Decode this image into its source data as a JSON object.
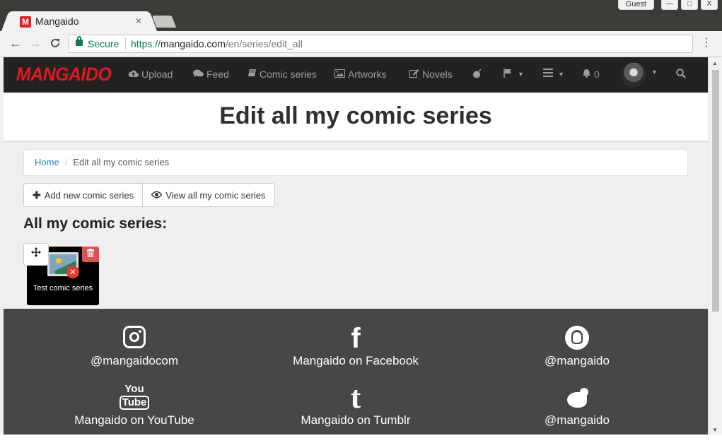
{
  "browser": {
    "window_buttons": {
      "guest": "Guest",
      "minimize": "—",
      "maximize": "□",
      "close": "X"
    },
    "tab": {
      "favicon": "M",
      "title": "Mangaido",
      "close": "×"
    },
    "nav": {
      "back": "←",
      "forward": "→",
      "reload": "C"
    },
    "address": {
      "secure_label": "Secure",
      "scheme": "https://",
      "host": "mangaido.com",
      "path": "/en/series/edit_all"
    },
    "menu": "⋮"
  },
  "navbar": {
    "brand": "MANGAIDO",
    "items": [
      {
        "icon": "☁",
        "label": "Upload"
      },
      {
        "icon": "💬",
        "label": "Feed"
      },
      {
        "icon": "📖",
        "label": "Comic series"
      },
      {
        "icon": "🖼",
        "label": "Artworks"
      },
      {
        "icon": "✎",
        "label": "Novels"
      }
    ],
    "notifications_count": "0"
  },
  "page": {
    "title": "Edit all my comic series",
    "breadcrumb": {
      "home": "Home",
      "separator": "/",
      "current": "Edit all my comic series"
    },
    "buttons": {
      "add_icon": "✚",
      "add_label": "Add new comic series",
      "view_icon": "👁",
      "view_label": "View all my comic series"
    },
    "section_heading": "All my comic series:",
    "series": [
      {
        "title": "Test comic series"
      }
    ]
  },
  "footer": {
    "socials": [
      {
        "icon": "instagram-icon",
        "label": "@mangaidocom"
      },
      {
        "icon": "facebook-icon",
        "label": "Mangaido on Facebook"
      },
      {
        "icon": "snapchat-icon",
        "label": "@mangaido"
      },
      {
        "icon": "youtube-icon",
        "label": "Mangaido on YouTube"
      },
      {
        "icon": "tumblr-icon",
        "label": "Mangaido on Tumblr"
      },
      {
        "icon": "twitter-icon",
        "label": "@mangaido"
      }
    ],
    "youtube_glyph_top": "You",
    "youtube_glyph_bottom": "Tube",
    "facebook_glyph": "f",
    "tumblr_glyph": "t"
  },
  "colors": {
    "brand_red": "#e0181f",
    "navbar_bg": "#222222",
    "link_blue": "#337ab7",
    "delete_red": "#d9534f",
    "footer_bg": "#474747",
    "secure_green": "#0b8043"
  }
}
